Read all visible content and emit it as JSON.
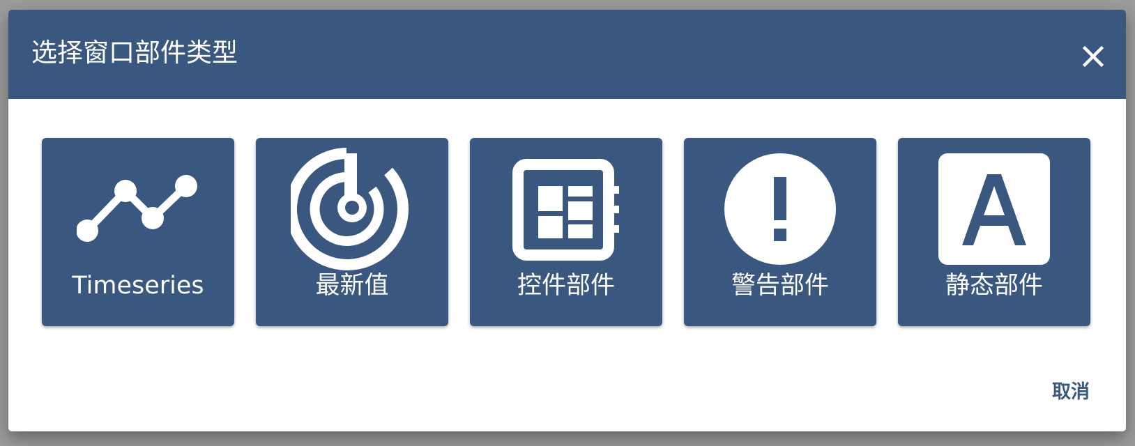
{
  "dialog": {
    "title": "选择窗口部件类型",
    "close_icon": "close-icon",
    "cancel_label": "取消"
  },
  "widget_types": [
    {
      "label": "Timeseries",
      "icon": "timeseries-chart-icon"
    },
    {
      "label": "最新值",
      "icon": "latest-value-gauge-icon"
    },
    {
      "label": "控件部件",
      "icon": "control-widget-icon"
    },
    {
      "label": "警告部件",
      "icon": "alarm-exclamation-icon"
    },
    {
      "label": "静态部件",
      "icon": "static-text-icon"
    }
  ],
  "colors": {
    "primary": "#3a5780",
    "backdrop": "#9b9b9b",
    "surface": "#ffffff"
  }
}
